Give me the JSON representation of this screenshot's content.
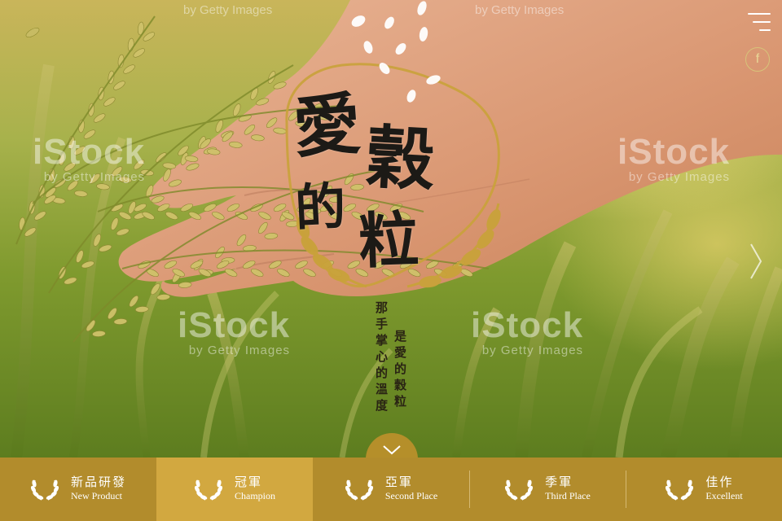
{
  "logo": {
    "line1": "愛",
    "line2": "穀",
    "line3": "的",
    "line4": "粒"
  },
  "poem": {
    "column1": "是愛的穀粒",
    "column2": "那手掌心的溫度"
  },
  "controls": {
    "menu_icon": "hamburger-icon",
    "facebook_label": "f",
    "next_icon": "chevron-right-icon",
    "scroll_icon": "chevron-down-icon"
  },
  "watermark": {
    "brand": "iStock",
    "byline": "by Getty Images"
  },
  "nav": {
    "items": [
      {
        "zh": "新品研發",
        "en": "New Product",
        "active": false
      },
      {
        "zh": "冠軍",
        "en": "Champion",
        "active": true
      },
      {
        "zh": "亞軍",
        "en": "Second Place",
        "active": false
      },
      {
        "zh": "季軍",
        "en": "Third Place",
        "active": false
      },
      {
        "zh": "佳作",
        "en": "Excellent",
        "active": false
      }
    ]
  },
  "colors": {
    "nav_bg": "#b28c2c",
    "nav_active": "#d2a840",
    "logo_gold": "#c9a23a",
    "logo_ink": "#1c1a16"
  }
}
